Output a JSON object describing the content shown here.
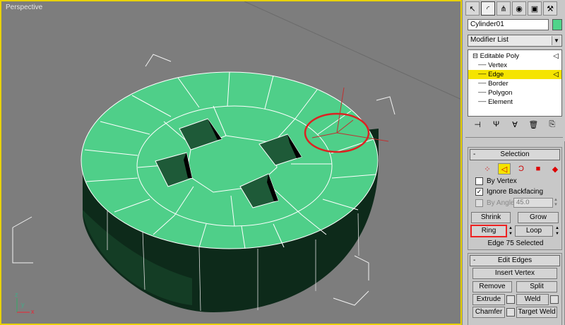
{
  "viewport": {
    "label": "Perspective",
    "axis_labels": {
      "x": "x",
      "y": "y",
      "z": "z"
    },
    "object_color": "#4fcf89",
    "selection_circle_color": "#dd2222"
  },
  "command_panel": {
    "tabs": [
      {
        "icon": "pointer-icon",
        "glyph": "↖",
        "active": false
      },
      {
        "icon": "modify-arc-icon",
        "glyph": "◜",
        "active": true
      },
      {
        "icon": "hierarchy-icon",
        "glyph": "⋔",
        "active": false
      },
      {
        "icon": "motion-icon",
        "glyph": "◉",
        "active": false
      },
      {
        "icon": "display-icon",
        "glyph": "▣",
        "active": false
      },
      {
        "icon": "utilities-hammer-icon",
        "glyph": "⚒",
        "active": false
      }
    ],
    "object_name": "Cylinder01",
    "object_color": "#4fd48a",
    "modifier_list": "Modifier List",
    "stack": {
      "root": "Editable Poly",
      "items": [
        "Vertex",
        "Edge",
        "Border",
        "Polygon",
        "Element"
      ],
      "selected": "Edge"
    },
    "stack_tools": [
      {
        "icon": "pin-stack-icon",
        "glyph": "⊣"
      },
      {
        "icon": "show-end-result-icon",
        "glyph": "Ψ"
      },
      {
        "icon": "make-unique-icon",
        "glyph": "∀"
      },
      {
        "icon": "remove-modifier-icon",
        "glyph": "🗑"
      },
      {
        "icon": "configure-modifier-sets-icon",
        "glyph": "⎘"
      }
    ],
    "selection": {
      "title": "Selection",
      "minus": "-",
      "sublevels": [
        {
          "icon": "vertex-level-icon",
          "glyph": "⁘"
        },
        {
          "icon": "edge-level-icon",
          "glyph": "◁"
        },
        {
          "icon": "border-level-icon",
          "glyph": "Ɔ"
        },
        {
          "icon": "polygon-level-icon",
          "glyph": "■"
        },
        {
          "icon": "element-level-icon",
          "glyph": "◆"
        }
      ],
      "by_vertex": {
        "label": "By Vertex",
        "checked": false
      },
      "ignore_backfacing": {
        "label": "Ignore Backfacing",
        "checked": true
      },
      "by_angle": {
        "label": "By Angle:",
        "checked": false,
        "value": "45.0"
      },
      "shrink": "Shrink",
      "grow": "Grow",
      "ring": "Ring",
      "loop": "Loop",
      "status": "Edge 75 Selected"
    },
    "edit_edges": {
      "title": "Edit Edges",
      "minus": "-",
      "insert_vertex": "Insert Vertex",
      "remove": "Remove",
      "split": "Split",
      "extrude": "Extrude",
      "weld": "Weld",
      "chamfer": "Chamfer",
      "target_weld": "Target Weld"
    }
  }
}
